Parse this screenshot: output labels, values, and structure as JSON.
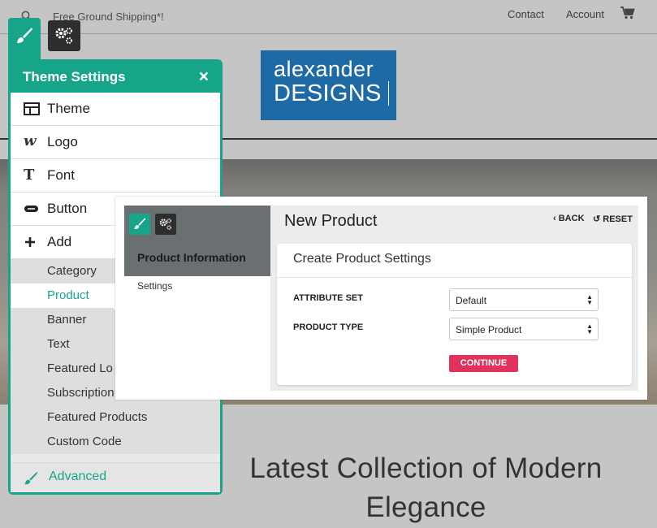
{
  "topbar": {
    "shipping_text": "Free Ground Shipping*!",
    "contact": "Contact",
    "account": "Account",
    "icons": [
      "search-icon",
      "cart-icon"
    ]
  },
  "logo": {
    "line1": "alexander",
    "line2": "DESIGNS",
    "color": "#1e6aa4"
  },
  "hero": {
    "headline": "Latest Collection of Modern Elegance"
  },
  "theme_settings": {
    "title": "Theme Settings",
    "close": "×",
    "accent": "#17a589",
    "items": [
      {
        "label": "Theme",
        "icon": "layout-icon"
      },
      {
        "label": "Logo",
        "icon": "logo-icon"
      },
      {
        "label": "Font",
        "icon": "font-icon"
      },
      {
        "label": "Button",
        "icon": "button-icon"
      },
      {
        "label": "Add",
        "icon": "plus-icon"
      }
    ],
    "add_items": [
      {
        "label": "Category"
      },
      {
        "label": "Product",
        "active": true
      },
      {
        "label": "Banner"
      },
      {
        "label": "Text"
      },
      {
        "label": "Featured Lo"
      },
      {
        "label": "Subscription"
      },
      {
        "label": "Featured Products"
      },
      {
        "label": "Custom Code"
      }
    ],
    "advanced": {
      "label": "Advanced",
      "icon": "brush-icon"
    }
  },
  "new_product": {
    "left_title": "Product Information",
    "left_link": "Settings",
    "title": "New Product",
    "back": "BACK",
    "reset": "RESET",
    "card_title": "Create Product Settings",
    "fields": [
      {
        "label": "ATTRIBUTE SET",
        "value": "Default"
      },
      {
        "label": "PRODUCT TYPE",
        "value": "Simple Product"
      }
    ],
    "continue": "CONTINUE",
    "continue_color": "#e0325a"
  }
}
